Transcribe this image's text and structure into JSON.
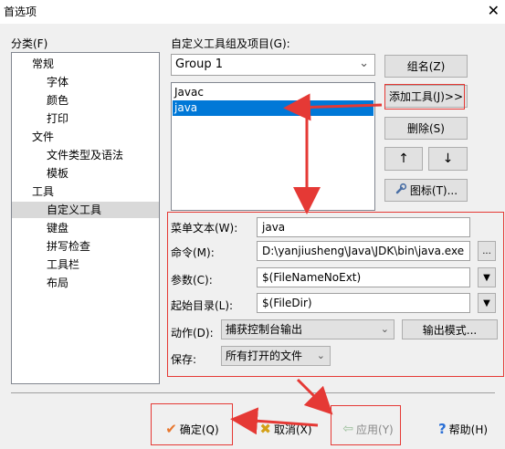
{
  "window": {
    "title": "首选项",
    "close_glyph": "✕"
  },
  "category": {
    "label": "分类(F)",
    "items": [
      {
        "label": "常规",
        "level": 1,
        "selected": false
      },
      {
        "label": "字体",
        "level": 2,
        "selected": false
      },
      {
        "label": "颜色",
        "level": 2,
        "selected": false
      },
      {
        "label": "打印",
        "level": 2,
        "selected": false
      },
      {
        "label": "文件",
        "level": 1,
        "selected": false
      },
      {
        "label": "文件类型及语法",
        "level": 2,
        "selected": false
      },
      {
        "label": "模板",
        "level": 2,
        "selected": false
      },
      {
        "label": "工具",
        "level": 1,
        "selected": false
      },
      {
        "label": "自定义工具",
        "level": 2,
        "selected": true
      },
      {
        "label": "键盘",
        "level": 2,
        "selected": false
      },
      {
        "label": "拼写检查",
        "level": 2,
        "selected": false
      },
      {
        "label": "工具栏",
        "level": 2,
        "selected": false
      },
      {
        "label": "布局",
        "level": 2,
        "selected": false
      }
    ]
  },
  "tools": {
    "group_label": "自定义工具组及项目(G):",
    "group_selected": "Group 1",
    "items": [
      {
        "label": "Javac",
        "selected": false
      },
      {
        "label": "java",
        "selected": true
      }
    ],
    "buttons": {
      "group_name": "组名(Z)",
      "add_tool": "添加工具(J)>>",
      "delete": "删除(S)",
      "move_up": "↑",
      "move_down": "↓",
      "icon": "图标(T)..."
    }
  },
  "details": {
    "menu_text_label": "菜单文本(W):",
    "menu_text_value": "java",
    "command_label": "命令(M):",
    "command_value": "D:\\yanjiusheng\\Java\\JDK\\bin\\java.exe",
    "browse": "...",
    "params_label": "参数(C):",
    "params_value": "$(FileNameNoExt)",
    "start_dir_label": "起始目录(L):",
    "start_dir_value": "$(FileDir)",
    "action_label": "动作(D):",
    "action_value": "捕获控制台输出",
    "output_mode": "输出模式...",
    "save_label": "保存:",
    "save_value": "所有打开的文件"
  },
  "footer": {
    "ok": "确定(Q)",
    "cancel": "取消(X)",
    "apply": "应用(Y)",
    "help": "帮助(H)"
  },
  "colors": {
    "accent_red": "#e53935",
    "selection_blue": "#0078d7",
    "ok_check": "#e8772e",
    "help_blue": "#2a6fd6"
  }
}
